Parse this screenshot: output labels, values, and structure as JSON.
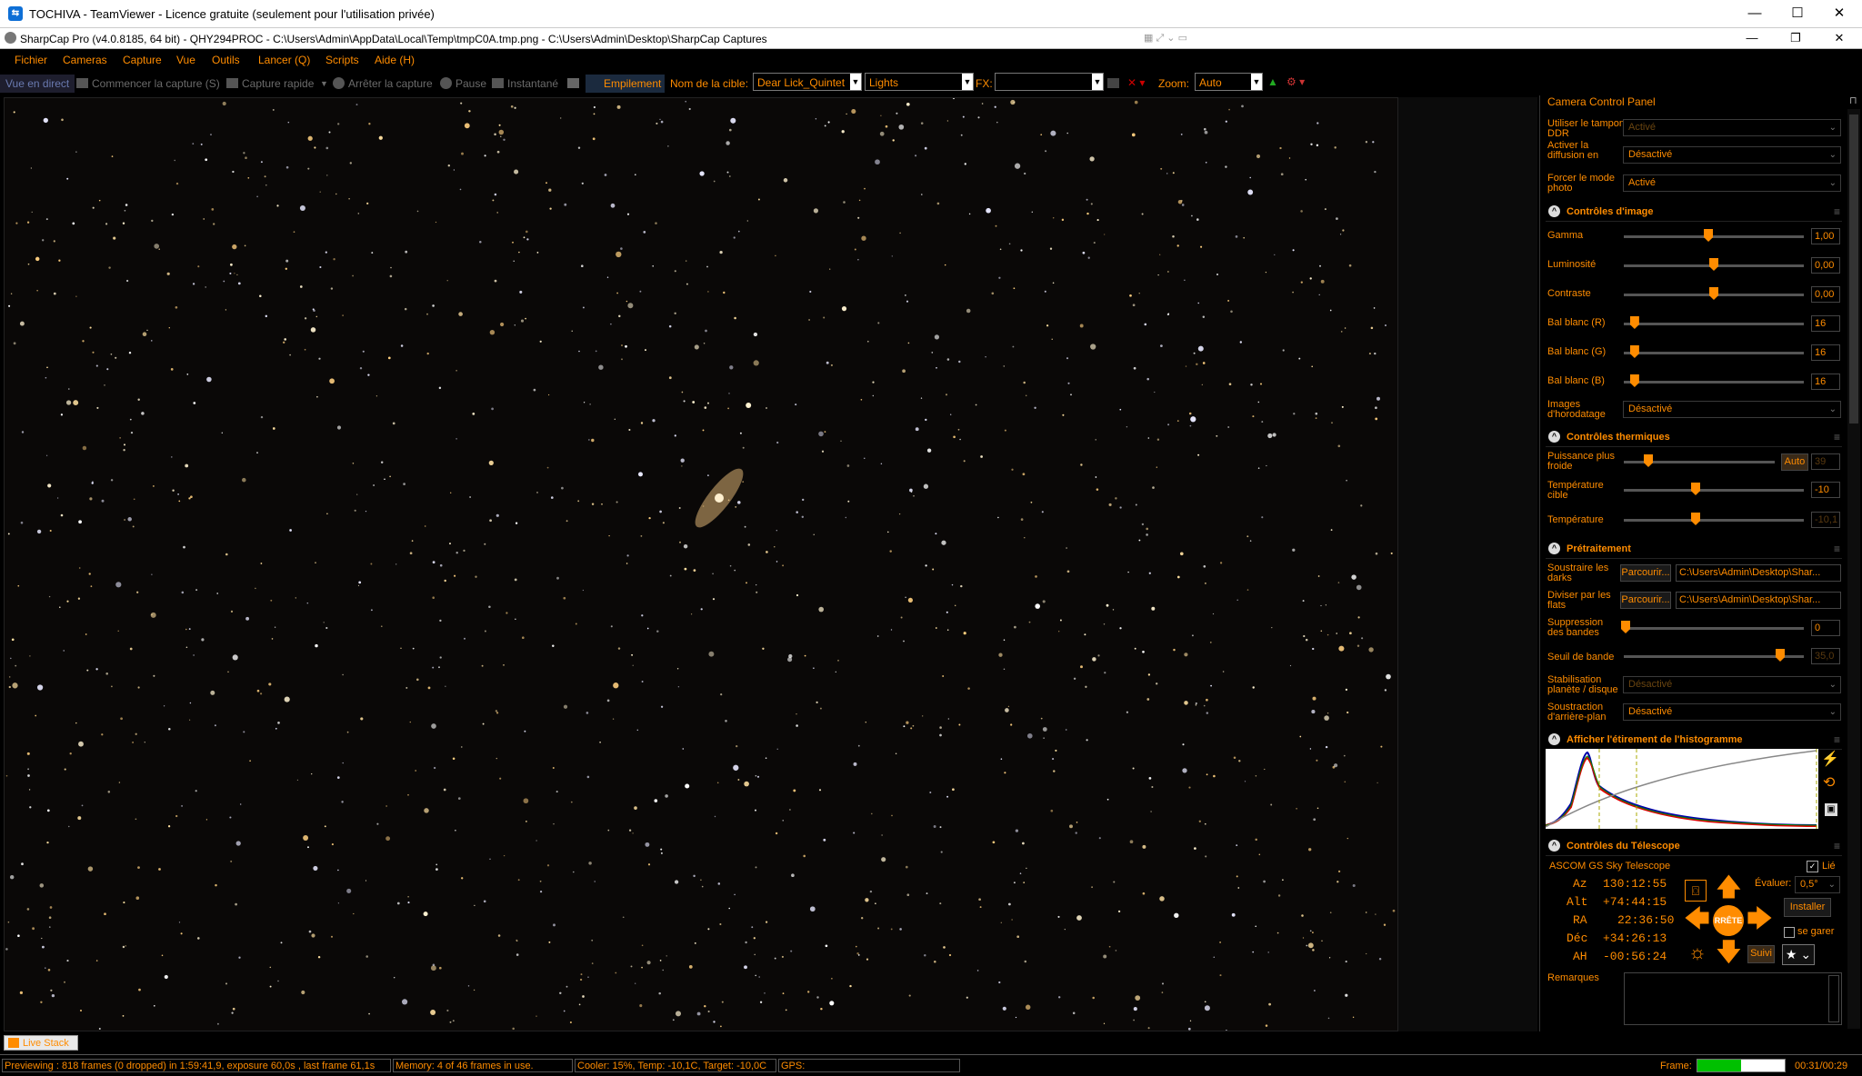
{
  "teamviewer": {
    "title": "TOCHIVA - TeamViewer - Licence gratuite (seulement pour l'utilisation privée)",
    "minimize": "—",
    "maximize": "☐",
    "close": "✕"
  },
  "sharpcap": {
    "title": "SharpCap Pro (v4.0.8185, 64 bit) - QHY294PROC - C:\\Users\\Admin\\AppData\\Local\\Temp\\tmpC0A.tmp.png - C:\\Users\\Admin\\Desktop\\SharpCap Captures",
    "minimize": "—",
    "restore": "❐",
    "close": "✕"
  },
  "menu": [
    "Fichier",
    "Cameras",
    "Capture",
    "Vue",
    "Outils",
    "Lancer (Q)",
    "Scripts",
    "Aide (H)"
  ],
  "toolbar": {
    "live_view": "Vue en direct",
    "start_capture": "Commencer la capture (S)",
    "quick_capture": "Capture rapide",
    "stop_capture": "Arrêter la capture",
    "pause": "Pause",
    "snapshot": "Instantané",
    "stacking": "Empilement",
    "target_label": "Nom de la cible:",
    "target_value": "Dear Lick_Quintet",
    "frame_type": "Lights",
    "fx_label": "FX:",
    "fx_value": "",
    "zoom_label": "Zoom:",
    "zoom_value": "Auto"
  },
  "panel": {
    "title": "Camera Control Panel",
    "top_settings": [
      {
        "label": "Utiliser le tampon DDR",
        "value": "Activé",
        "dim": true
      },
      {
        "label": "Activer la diffusion en direct",
        "value": "Désactivé",
        "dim": false
      },
      {
        "label": "Forcer le mode photo",
        "value": "Activé",
        "dim": false
      }
    ],
    "image_controls": {
      "title": "Contrôles d'image",
      "sliders": [
        {
          "label": "Gamma",
          "value": "1,00",
          "pos": 0.47
        },
        {
          "label": "Luminosité",
          "value": "0,00",
          "pos": 0.5
        },
        {
          "label": "Contraste",
          "value": "0,00",
          "pos": 0.5
        },
        {
          "label": "Bal blanc (R)",
          "value": "16",
          "pos": 0.06
        },
        {
          "label": "Bal blanc (G)",
          "value": "16",
          "pos": 0.06
        },
        {
          "label": "Bal blanc (B)",
          "value": "16",
          "pos": 0.06
        }
      ],
      "timestamp_label": "Images d'horodatage",
      "timestamp_value": "Désactivé"
    },
    "thermal": {
      "title": "Contrôles thermiques",
      "power_label": "Puissance plus froide",
      "power_auto": "Auto",
      "power_value": "39",
      "target_temp_label": "Température cible",
      "target_temp_value": "-10",
      "temp_label": "Température",
      "temp_value": "-10,1"
    },
    "preprocessing": {
      "title": "Prétraitement",
      "darks_label": "Soustraire les darks",
      "flats_label": "Diviser par les flats",
      "browse": "Parcourir...",
      "darks_path": "C:\\Users\\Admin\\Desktop\\Shar...",
      "flats_path": "C:\\Users\\Admin\\Desktop\\Shar...",
      "band_supp_label": "Suppression des bandes",
      "band_supp_value": "0",
      "band_thresh_label": "Seuil de bande",
      "band_thresh_value": "35,0",
      "stabilisation_label": "Stabilisation planète / disque",
      "stabilisation_value": "Désactivé",
      "bg_sub_label": "Soustraction d'arrière-plan",
      "bg_sub_value": "Désactivé"
    },
    "histogram": {
      "title": "Afficher l'étirement de l'histogramme"
    },
    "telescope": {
      "title": "Contrôles du Télescope",
      "name": "ASCOM GS Sky Telescope",
      "linked": "Lié",
      "az_label": "Az",
      "az": "130:12:55",
      "alt_label": "Alt",
      "alt": "+74:44:15",
      "ra_label": "RA",
      "ra": "22:36:50",
      "dec_label": "Déc",
      "dec": "+34:26:13",
      "ah_label": "AH",
      "ah": "-00:56:24",
      "rate_label": "Évaluer:",
      "rate_value": "0,5°",
      "install": "Installer",
      "park": "se garer",
      "stop": "RRÊTE",
      "track": "Suivi"
    },
    "notes_label": "Remarques"
  },
  "bottom": {
    "live_stack_tab": "Live Stack",
    "status_preview": "Previewing : 818 frames (0 dropped) in 1:59:41,9, exposure 60,0s , last frame 61,1s",
    "status_memory": "Memory: 4 of 46 frames in use.",
    "status_cooler": "Cooler: 15%, Temp: -10,1C, Target: -10,0C",
    "status_gps": "GPS:",
    "frame_label": "Frame:",
    "frame_progress": 0.5,
    "frame_time": "00:31/00:29"
  },
  "colors": {
    "accent": "#ff8c00",
    "background": "#000000"
  }
}
